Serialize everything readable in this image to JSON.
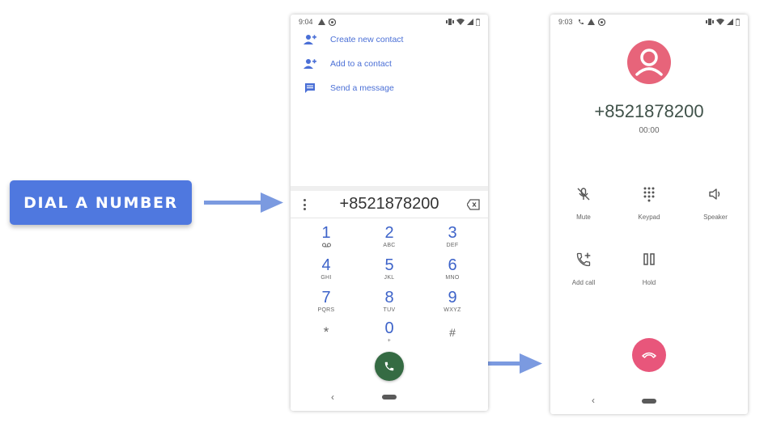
{
  "label": "DIAL A NUMBER",
  "phone1": {
    "status": {
      "time": "9:04"
    },
    "actions": [
      {
        "label": "Create new contact",
        "icon": "add-person-icon"
      },
      {
        "label": "Add to a contact",
        "icon": "add-person-icon"
      },
      {
        "label": "Send a message",
        "icon": "message-icon"
      }
    ],
    "dialed_number": "+8521878200",
    "keys": [
      {
        "digit": "1",
        "letters": ""
      },
      {
        "digit": "2",
        "letters": "ABC"
      },
      {
        "digit": "3",
        "letters": "DEF"
      },
      {
        "digit": "4",
        "letters": "GHI"
      },
      {
        "digit": "5",
        "letters": "JKL"
      },
      {
        "digit": "6",
        "letters": "MNO"
      },
      {
        "digit": "7",
        "letters": "PQRS"
      },
      {
        "digit": "8",
        "letters": "TUV"
      },
      {
        "digit": "9",
        "letters": "WXYZ"
      },
      {
        "digit": "*",
        "letters": ""
      },
      {
        "digit": "0",
        "letters": "+"
      },
      {
        "digit": "#",
        "letters": ""
      }
    ],
    "nav_back": "‹"
  },
  "phone2": {
    "status": {
      "time": "9:03"
    },
    "number": "+8521878200",
    "timer": "00:00",
    "controls": [
      {
        "label": "Mute",
        "icon": "mic-off-icon"
      },
      {
        "label": "Keypad",
        "icon": "dialpad-icon"
      },
      {
        "label": "Speaker",
        "icon": "speaker-icon"
      },
      {
        "label": "Add call",
        "icon": "add-call-icon"
      },
      {
        "label": "Hold",
        "icon": "pause-icon"
      }
    ],
    "nav_back": "‹"
  },
  "colors": {
    "label_bg": "#4f78df",
    "accent_blue": "#3d63c9",
    "call_green": "#356b43",
    "end_call_pink": "#e8567b",
    "avatar_pink": "#e7647a",
    "arrow_blue": "#7b9ae0"
  }
}
